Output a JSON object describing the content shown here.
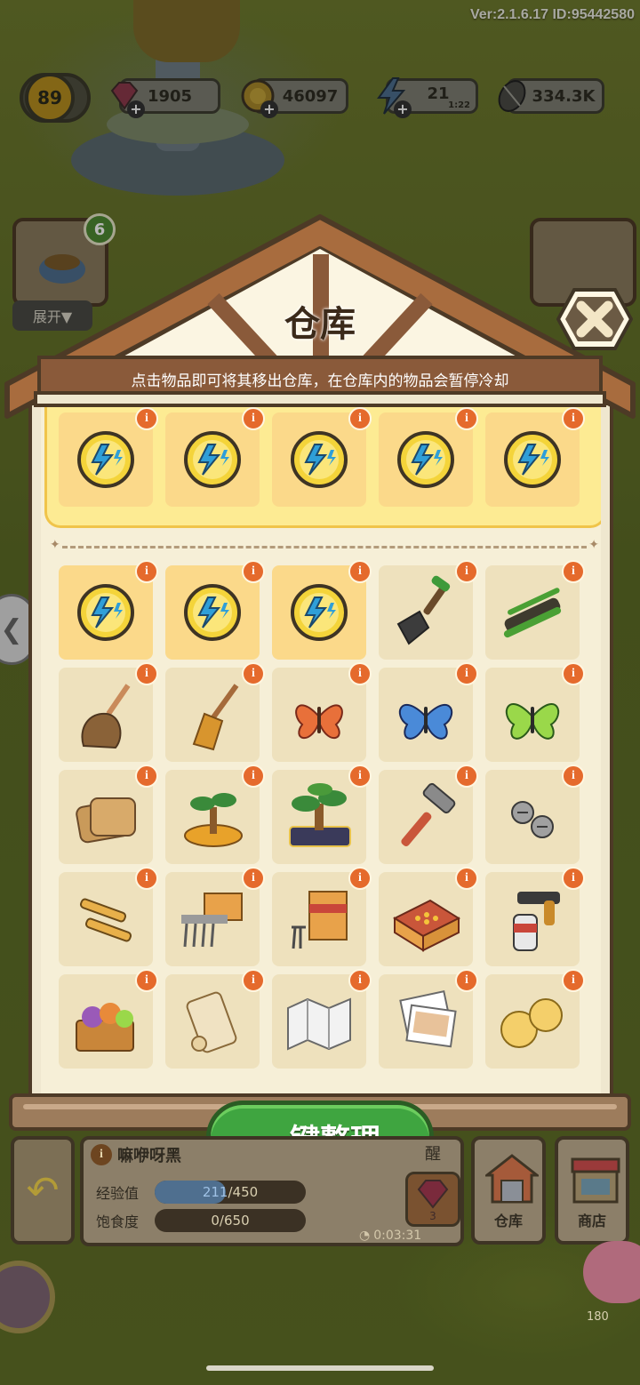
{
  "status": {
    "version_text": "Ver:2.1.6.17 ID:95442580"
  },
  "top_bar": {
    "level": "89",
    "gems": "1905",
    "coins": "46097",
    "energy": "21",
    "energy_timer": "1:22",
    "seeds": "334.3K"
  },
  "background": {
    "card_badge": "6",
    "expand_label": "展开▼"
  },
  "warehouse": {
    "title": "仓库",
    "hint": "点击物品即可将其移出仓库，在仓库内的物品会暂停冷却",
    "info_glyph": "i",
    "sort_button_label": "一键整理",
    "cooling_items": [
      "energy-coin",
      "energy-coin",
      "energy-coin",
      "energy-coin",
      "energy-coin"
    ],
    "stored_items": [
      [
        "energy-coin",
        "energy-coin",
        "energy-coin",
        "shovel",
        "sled"
      ],
      [
        "feather-duster",
        "broom",
        "orange-butterfly",
        "blue-butterfly",
        "green-butterfly"
      ],
      [
        "burlap-sacks",
        "small-bonsai",
        "large-bonsai",
        "hammer",
        "screws"
      ],
      [
        "syringes",
        "nail-pack",
        "tool-box",
        "bullet-box",
        "spray-gun"
      ],
      [
        "yarn-basket",
        "scroll",
        "folded-map",
        "photos",
        "gold-orbs"
      ]
    ]
  },
  "bottom_hud": {
    "pet_name": "嘛咿呀黑",
    "pet_name_suffix": "醒",
    "exp_label": "经验值",
    "exp_current": "211",
    "exp_max": "/450",
    "exp_fraction": 0.469,
    "hunger_label": "饱食度",
    "hunger_current": "0",
    "hunger_max": "/650",
    "hunger_fraction": 0.0,
    "gem_count": "3",
    "timer": "0:03:31",
    "warehouse_label": "仓库",
    "shop_label": "商店",
    "side_value": "180"
  },
  "colors": {
    "accent_green": "#3fa540",
    "info_badge": "#e56a2c",
    "wood": "#8a5a3a",
    "panel": "#f6efd7"
  }
}
